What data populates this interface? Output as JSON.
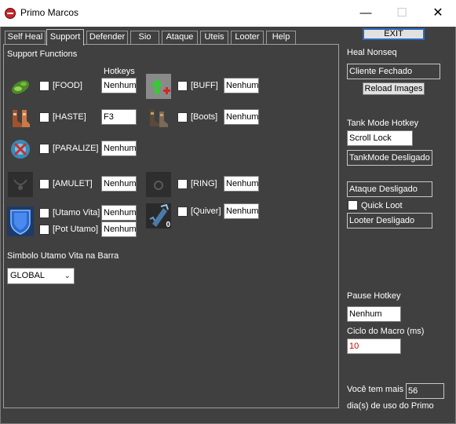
{
  "window": {
    "title": "Primo Marcos",
    "minimize_glyph": "—",
    "maximize_glyph": "☐",
    "close_glyph": "✕"
  },
  "tabs": [
    "Self Heal",
    "Support",
    "Defender",
    "Sio",
    "Ataque",
    "Uteis",
    "Looter",
    "Help"
  ],
  "active_tab": "Support",
  "support": {
    "title": "Support Functions",
    "hotkeys_header": "Hotkeys",
    "food": {
      "label": "[FOOD]",
      "hotkey": "Nenhum",
      "icon": "food-icon"
    },
    "buff": {
      "label": "[BUFF]",
      "hotkey": "Nenhum",
      "icon": "buff-arrow-icon"
    },
    "haste": {
      "label": "[HASTE]",
      "hotkey": "F3",
      "icon": "haste-boots-icon"
    },
    "boots": {
      "label": "[Boots]",
      "hotkey": "Nenhum",
      "icon": "boots-icon"
    },
    "paralize": {
      "label": "[PARALIZE]",
      "hotkey": "Nenhum",
      "icon": "paralize-icon"
    },
    "amulet": {
      "label": "[AMULET]",
      "hotkey": "Nenhum",
      "icon": "amulet-slot-icon"
    },
    "ring": {
      "label": "[RING]",
      "hotkey": "Nenhum",
      "icon": "ring-slot-icon"
    },
    "utamo_vita": {
      "label": "[Utamo Vita]",
      "hotkey": "Nenhum",
      "icon": "shield-icon"
    },
    "pot_utamo": {
      "label": "[Pot Utamo]",
      "hotkey": "Nenhum"
    },
    "quiver": {
      "label": "[Quiver]",
      "hotkey": "Nenhum",
      "icon": "quiver-icon",
      "count": "0"
    },
    "simbolo_label": "Simbolo Utamo Vita na Barra",
    "simbolo_value": "GLOBAL"
  },
  "right": {
    "exit_label": "EXIT",
    "heal_nonseq_label": "Heal Nonseq",
    "client_status": "Cliente Fechado",
    "reload_label": "Reload Images",
    "tank_hotkey_label": "Tank Mode Hotkey",
    "tank_hotkey_value": "Scroll Lock",
    "tankmode_status": "TankMode Desligado",
    "ataque_status": "Ataque Desligado",
    "quick_loot_label": "Quick Loot",
    "looter_status": "Looter Desligado",
    "pause_hotkey_label": "Pause Hotkey",
    "pause_hotkey_value": "Nenhum",
    "ciclo_label": "Ciclo do Macro (ms)",
    "ciclo_value": "10",
    "days_label_1": "Você tem mais",
    "days_value": "56",
    "days_label_2": "dia(s) de uso do Primo"
  },
  "colors": {
    "background": "#404040",
    "text": "#ffffff",
    "ciclo_value": "#cc0000",
    "exit_border": "#2a6ac0"
  }
}
